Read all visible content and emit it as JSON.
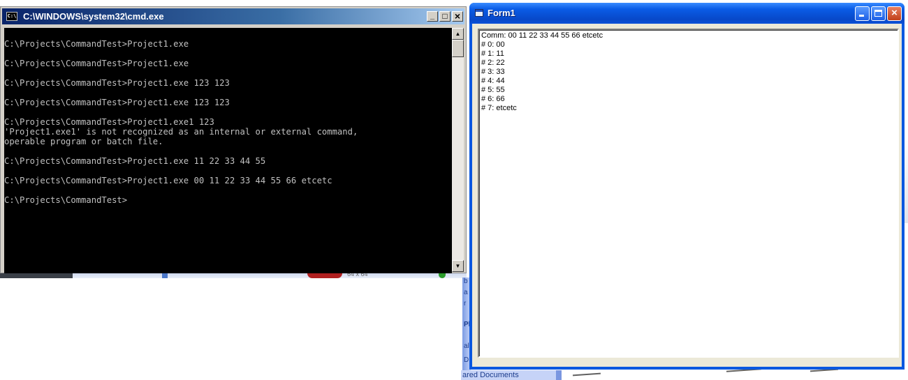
{
  "cmd_window": {
    "title": "C:\\WINDOWS\\system32\\cmd.exe",
    "icon": "console-icon",
    "icon_text": "C:\\",
    "lines": [
      "",
      "C:\\Projects\\CommandTest>Project1.exe",
      "",
      "C:\\Projects\\CommandTest>Project1.exe",
      "",
      "C:\\Projects\\CommandTest>Project1.exe 123 123",
      "",
      "C:\\Projects\\CommandTest>Project1.exe 123 123",
      "",
      "C:\\Projects\\CommandTest>Project1.exe1 123",
      "'Project1.exe1' is not recognized as an internal or external command,",
      "operable program or batch file.",
      "",
      "C:\\Projects\\CommandTest>Project1.exe 11 22 33 44 55",
      "",
      "C:\\Projects\\CommandTest>Project1.exe 00 11 22 33 44 55 66 etcetc",
      "",
      "C:\\Projects\\CommandTest>"
    ],
    "buttons": {
      "minimize": "_",
      "maximize": "□",
      "close": "×"
    },
    "scroll_up": "▲",
    "scroll_down": "▼"
  },
  "form1_window": {
    "title": "Form1",
    "close_label": "×",
    "memo_lines": [
      "Comm: 00 11 22 33 44 55 66 etcetc",
      "# 0: 00",
      "# 1: 11",
      "# 2: 22",
      "# 3: 33",
      "# 4: 44",
      "# 5: 55",
      "# 6: 66",
      "# 7: etcetc"
    ]
  },
  "background": {
    "shared_documents": "ared Documents",
    "size_fragment": "64 x 64",
    "panel_fragments": [
      "b",
      "a",
      "r",
      "Pl",
      "al",
      "D",
      "ar"
    ]
  },
  "colors": {
    "console_bg": "#000000",
    "console_text": "#c0c0c0",
    "xp_blue": "#0a58e0",
    "classic_title": "#0a246a"
  }
}
